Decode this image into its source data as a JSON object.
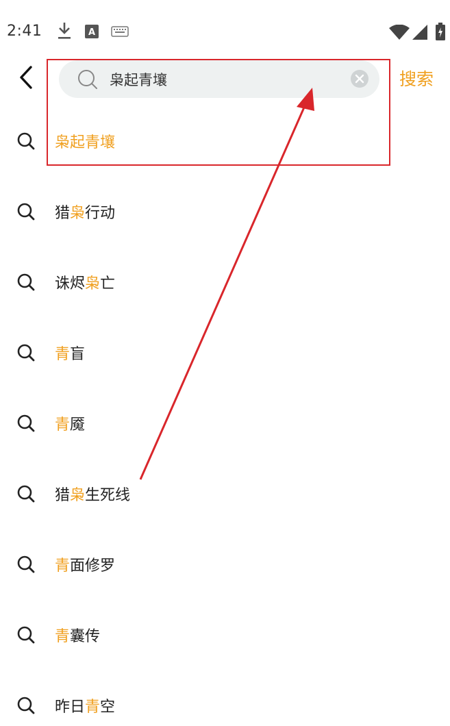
{
  "status_bar": {
    "time": "2:41",
    "icons": [
      "download-icon",
      "a-notification-icon",
      "keyboard-icon",
      "wifi-icon",
      "signal-icon",
      "battery-charging-icon"
    ]
  },
  "header": {
    "back_icon": "chevron-left-icon",
    "search": {
      "value": "枭起青壤",
      "icon": "search-icon",
      "clear_icon": "clear-icon"
    },
    "search_button_label": "搜索"
  },
  "colors": {
    "accent": "#f0a020",
    "search_bg": "#eef1f1",
    "annotation": "#d9262b"
  },
  "suggestions": [
    {
      "parts": [
        {
          "t": "枭起青壤",
          "h": true
        }
      ]
    },
    {
      "parts": [
        {
          "t": "猎",
          "h": false
        },
        {
          "t": "枭",
          "h": true
        },
        {
          "t": "行动",
          "h": false
        }
      ]
    },
    {
      "parts": [
        {
          "t": "诛烬",
          "h": false
        },
        {
          "t": "枭",
          "h": true
        },
        {
          "t": "亡",
          "h": false
        }
      ]
    },
    {
      "parts": [
        {
          "t": "青",
          "h": true
        },
        {
          "t": "盲",
          "h": false
        }
      ]
    },
    {
      "parts": [
        {
          "t": "青",
          "h": true
        },
        {
          "t": "魇",
          "h": false
        }
      ]
    },
    {
      "parts": [
        {
          "t": "猎",
          "h": false
        },
        {
          "t": "枭",
          "h": true
        },
        {
          "t": "生死线",
          "h": false
        }
      ]
    },
    {
      "parts": [
        {
          "t": "青",
          "h": true
        },
        {
          "t": "面修罗",
          "h": false
        }
      ]
    },
    {
      "parts": [
        {
          "t": "青",
          "h": true
        },
        {
          "t": "囊传",
          "h": false
        }
      ]
    },
    {
      "parts": [
        {
          "t": "昨日",
          "h": false
        },
        {
          "t": "青",
          "h": true
        },
        {
          "t": "空",
          "h": false
        }
      ]
    }
  ]
}
